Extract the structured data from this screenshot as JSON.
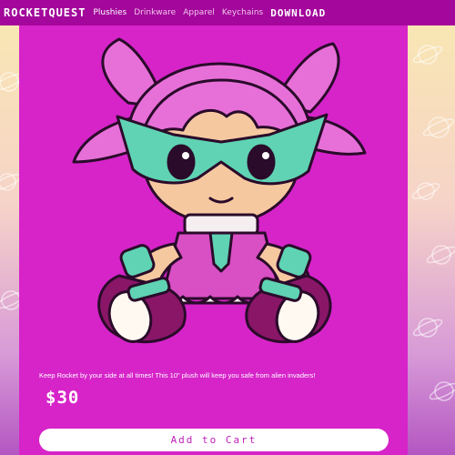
{
  "navbar": {
    "brand": "ROCKETQUEST",
    "links": [
      "Plushies",
      "Drinkware",
      "Apparel",
      "Keychains"
    ],
    "download": "DOWNLOAD"
  },
  "product": {
    "image_icon": "rocket-plush-illustration",
    "description": "Keep Rocket by your side at all times! This 10\" plush will keep you safe from alien invaders!",
    "price": "$30",
    "add_to_cart": "Add to Cart"
  },
  "colors": {
    "navbar": "#a3079b",
    "card": "#d624c9",
    "button": "#ffffff",
    "button_text": "#c01fbd"
  }
}
